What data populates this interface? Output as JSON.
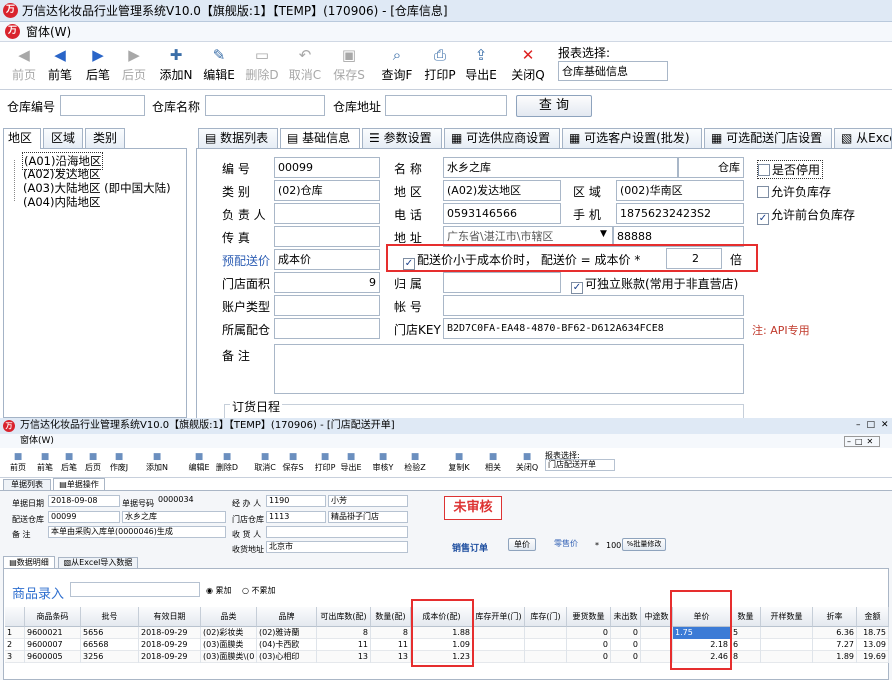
{
  "window": {
    "title": "万信达化妆品行业管理系统V10.0【旗舰版:1】【TEMP】(170906) - [仓库信息]",
    "menu": "窗体(W)"
  },
  "toolbar": {
    "items": [
      {
        "label": "前页",
        "icon": "first-page-icon",
        "glyph": "◀",
        "enabled": false
      },
      {
        "label": "前笔",
        "icon": "prev-icon",
        "glyph": "◀",
        "enabled": true
      },
      {
        "label": "后笔",
        "icon": "next-icon",
        "glyph": "▶",
        "enabled": true
      },
      {
        "label": "后页",
        "icon": "last-page-icon",
        "glyph": "▶",
        "enabled": false
      },
      {
        "label": "添加N",
        "icon": "add-icon",
        "glyph": "✚",
        "enabled": true
      },
      {
        "label": "编辑E",
        "icon": "edit-icon",
        "glyph": "✎",
        "enabled": true
      },
      {
        "label": "删除D",
        "icon": "delete-icon",
        "glyph": "▭",
        "enabled": false
      },
      {
        "label": "取消C",
        "icon": "undo-icon",
        "glyph": "↶",
        "enabled": false
      },
      {
        "label": "保存S",
        "icon": "save-icon",
        "glyph": "▣",
        "enabled": false
      },
      {
        "label": "查询F",
        "icon": "query-icon",
        "glyph": "⌕",
        "enabled": true
      },
      {
        "label": "打印P",
        "icon": "print-icon",
        "glyph": "⎙",
        "enabled": true
      },
      {
        "label": "导出E",
        "icon": "export-icon",
        "glyph": "⇪",
        "enabled": true
      },
      {
        "label": "关闭Q",
        "icon": "close-icon",
        "glyph": "✕",
        "enabled": true
      }
    ],
    "report_label": "报表选择:",
    "report_value": "仓库基础信息"
  },
  "search": {
    "code_label": "仓库编号",
    "name_label": "仓库名称",
    "addr_label": "仓库地址",
    "query_button": "查 询"
  },
  "left_tabs": [
    "地区",
    "区域",
    "类别"
  ],
  "tree": [
    "(A01)沿海地区",
    "(A02)发达地区",
    "(A03)大陆地区 (即中国大陆)",
    "(A04)内陆地区"
  ],
  "tabs": [
    "数据列表",
    "基础信息",
    "参数设置",
    "可选供应商设置",
    "可选客户设置(批发)",
    "可选配送门店设置",
    "从Exce"
  ],
  "form": {
    "code_label": "编  号",
    "code": "00099",
    "name_label": "名  称",
    "name": "水乡之库",
    "name_suffix": "仓库",
    "type_label": "类  别",
    "type": "(02)仓库",
    "region_label": "地  区",
    "region": "(A02)发达地区",
    "area_label": "区  域",
    "area": "(002)华南区",
    "manager_label": "负 责 人",
    "phone_label": "电  话",
    "phone": "0593146566",
    "mobile_label": "手  机",
    "mobile": "18756232423S2",
    "fax_label": "传  真",
    "address_label": "地  址",
    "address": "广东省\\湛江市\\市辖区",
    "address2": "88888",
    "price_label": "预配送价",
    "price": "成本价",
    "price_rule_label": "配送价小于成本价时， 配送价 = 成本价 *",
    "price_rule_value": "2",
    "price_rule_unit": "倍",
    "store_area_label": "门店面积",
    "store_area": "9",
    "belong_label": "归  属",
    "account_type_label": "账户类型",
    "account_label": "帐  号",
    "dist_label": "所属配仓",
    "store_key_label": "门店KEY",
    "store_key": "B2D7C0FA-EA48-4870-BF62-D612A634FCE8",
    "api_note": "注: API专用",
    "remark_label": "备  注",
    "order_schedule": "订货日程",
    "checks": {
      "disabled": "是否停用",
      "allow_negative": "允许负库存",
      "allow_front_negative": "允许前台负库存",
      "independent_account": "可独立账款(常用于非直营店)"
    }
  },
  "sub": {
    "title": "万信达化妆品行业管理系统V10.0【旗舰版:1】【TEMP】(170906) - [门店配送开单]",
    "menu": "窗体(W)",
    "tools": [
      "前页",
      "前笔",
      "后笔",
      "后页",
      "作废J",
      "添加N",
      "编辑E",
      "删除D",
      "取消C",
      "保存S",
      "打印P",
      "导出E",
      "审核Y",
      "检验Z",
      "复制K",
      "相关",
      "关闭Q"
    ],
    "report_label": "报表选择:",
    "report_value": "门店配送开单",
    "tabs": [
      "单据列表",
      "单据操作"
    ],
    "date_label": "单据日期",
    "date": "2018-09-08",
    "bill_label": "单据号码",
    "bill": "0000034",
    "handler_label": "经 办 人",
    "handler": "1190",
    "handler_name": "小芳",
    "wh_label": "配送仓库",
    "wh_code": "00099",
    "wh_name": "水乡之库",
    "store_label": "门店仓库",
    "store_code": "1113",
    "store_name": "精品褂子门店",
    "note_label": "备  注",
    "note": "本单由采购入库单(0000046)生成",
    "recv_label": "收 货 人",
    "recv_addr_label": "收货地址",
    "recv_addr": "北京市",
    "status": "未审核",
    "sale_order": "销售订单",
    "unit_price_btn": "单价",
    "retail": "零售价",
    "star": "*",
    "ratio": "100",
    "batch_btn": "%批量修改",
    "detail_tabs": [
      "数据明细",
      "从Excel导入数据"
    ],
    "entry_title": "商品录入",
    "radio_accum": "累加",
    "radio_no_accum": "不累加",
    "columns": [
      "",
      "商品条码",
      "批号",
      "有效日期",
      "品类",
      "品牌",
      "可出库数(配)",
      "数量(配)",
      "成本价(配)",
      "库存开单(门)",
      "库存(门)",
      "要货数量",
      "未出数",
      "中途数",
      "单价",
      "数量",
      "开样数量",
      "折率",
      "金额"
    ],
    "rows": [
      [
        "1",
        "9600021",
        "5656",
        "2018-09-29",
        "(02)彩妆类",
        "(02)雅诗蘭",
        "8",
        "8",
        "1.88",
        "",
        "",
        "0",
        "0",
        "",
        "1.75",
        "5",
        "",
        "6.36",
        "18.75"
      ],
      [
        "2",
        "9600007",
        "66568",
        "2018-09-29",
        "(03)面膜类",
        "(04)卡西欧",
        "11",
        "11",
        "1.09",
        "",
        "",
        "0",
        "0",
        "",
        "2.18",
        "6",
        "",
        "7.27",
        "13.09"
      ],
      [
        "3",
        "9600005",
        "3256",
        "2018-09-29",
        "(03)面膜类\\(0",
        "(03)心相印",
        "13",
        "13",
        "1.23",
        "",
        "",
        "0",
        "0",
        "",
        "2.46",
        "8",
        "",
        "1.89",
        "19.69"
      ]
    ]
  }
}
